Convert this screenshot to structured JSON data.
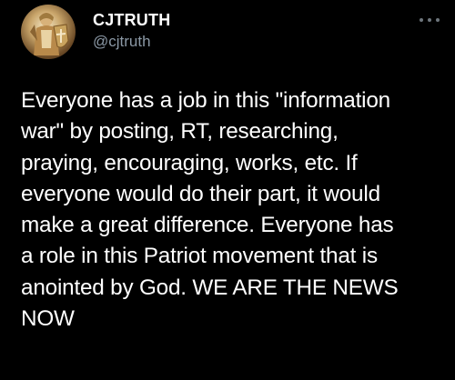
{
  "tweet": {
    "display_name": "CJTRUTH",
    "handle": "@cjtruth",
    "more_icon": "more-horizontal-icon",
    "avatar_icon": "knight-avatar-icon",
    "text": "Everyone has a job in this \"information\nwar\" by posting, RT, researching,\npraying, encouraging, works, etc. If\neveryone would do their part, it would\nmake a great difference. Everyone has\na role in this Patriot movement that is\nanointed by God.  WE ARE THE NEWS\nNOW"
  },
  "colors": {
    "background": "#000000",
    "text": "#ffffff",
    "secondary_text": "#8b98a5",
    "icon": "#6e767d"
  }
}
